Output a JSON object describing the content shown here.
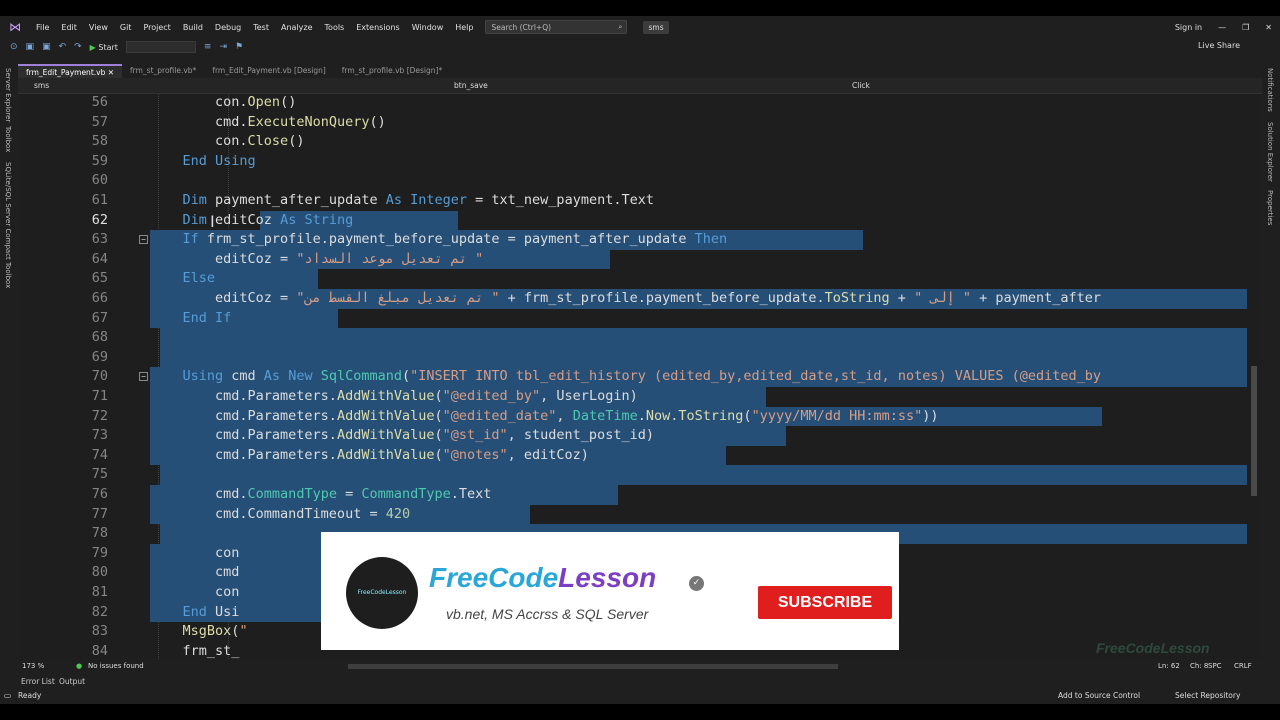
{
  "menubar": {
    "items": [
      "File",
      "Edit",
      "View",
      "Git",
      "Project",
      "Build",
      "Debug",
      "Test",
      "Analyze",
      "Tools",
      "Extensions",
      "Window",
      "Help"
    ],
    "search_placeholder": "Search (Ctrl+Q)",
    "solution_badge": "sms",
    "sign_in": "Sign in"
  },
  "toolbar": {
    "start_label": "Start",
    "live_share": "Live Share"
  },
  "left_strip": [
    "Server Explorer",
    "Toolbox",
    "SQLite/SQL Server Compact Toolbox"
  ],
  "right_strip": [
    "Notifications",
    "Solution Explorer",
    "Properties"
  ],
  "tabs": [
    {
      "label": "frm_Edit_Payment.vb"
    },
    {
      "label": "frm_st_profile.vb*"
    },
    {
      "label": "frm_Edit_Payment.vb [Design]"
    },
    {
      "label": "frm_st_profile.vb [Design]*"
    }
  ],
  "navbar": {
    "project": "sms",
    "object": "btn_save",
    "event": "Click"
  },
  "code_lines": [
    {
      "n": "56",
      "code": "        con.Open()"
    },
    {
      "n": "57",
      "code": "        cmd.ExecuteNonQuery()"
    },
    {
      "n": "58",
      "code": "        con.Close()"
    },
    {
      "n": "59",
      "code": "    End Using"
    },
    {
      "n": "60",
      "code": ""
    },
    {
      "n": "61",
      "code": "    Dim payment_after_update As Integer = txt_new_payment.Text"
    },
    {
      "n": "62",
      "code": "    Dim editCoz As String"
    },
    {
      "n": "63",
      "code": "    If frm_st_profile.payment_before_update = payment_after_update Then"
    },
    {
      "n": "64",
      "code": "        editCoz = \"تم تعديل موعد السداد \""
    },
    {
      "n": "65",
      "code": "    Else"
    },
    {
      "n": "66",
      "code": "        editCoz = \"تم تعديل مبلغ القسط من \" + frm_st_profile.payment_before_update.ToString + \" إلى \" + payment_after"
    },
    {
      "n": "67",
      "code": "    End If"
    },
    {
      "n": "68",
      "code": ""
    },
    {
      "n": "69",
      "code": ""
    },
    {
      "n": "70",
      "code": "    Using cmd As New SqlCommand(\"INSERT INTO tbl_edit_history (edited_by,edited_date,st_id, notes) VALUES (@edited_by"
    },
    {
      "n": "71",
      "code": "        cmd.Parameters.AddWithValue(\"@edited_by\", UserLogin)"
    },
    {
      "n": "72",
      "code": "        cmd.Parameters.AddWithValue(\"@edited_date\", DateTime.Now.ToString(\"yyyy/MM/dd HH:mm:ss\"))"
    },
    {
      "n": "73",
      "code": "        cmd.Parameters.AddWithValue(\"@st_id\", student_post_id)"
    },
    {
      "n": "74",
      "code": "        cmd.Parameters.AddWithValue(\"@notes\", editCoz)"
    },
    {
      "n": "75",
      "code": ""
    },
    {
      "n": "76",
      "code": "        cmd.CommandType = CommandType.Text"
    },
    {
      "n": "77",
      "code": "        cmd.CommandTimeout = 420"
    },
    {
      "n": "78",
      "code": ""
    },
    {
      "n": "79",
      "code": "        con"
    },
    {
      "n": "80",
      "code": "        cmd"
    },
    {
      "n": "81",
      "code": "        con"
    },
    {
      "n": "82",
      "code": "    End Usi"
    },
    {
      "n": "83",
      "code": "    MsgBox(\"                                                  ... جاري ال\")"
    },
    {
      "n": "84",
      "code": "    frm_st_"
    }
  ],
  "editor_status": {
    "zoom": "173 %",
    "issues": "No issues found",
    "ln": "Ln: 62",
    "ch": "Ch: 8",
    "spc": "SPC",
    "crlf": "CRLF"
  },
  "panel_tabs": [
    "Error List",
    "Output"
  ],
  "statusbar": {
    "ready": "Ready",
    "source_control": "Add to Source Control",
    "repo": "Select Repository"
  },
  "promo": {
    "brand_part1": "FreeCode",
    "brand_part2": "Lesson",
    "tagline": "vb.net,  MS Accrss & SQL Server",
    "subscribe": "SUBSCRIBE",
    "avatar_text": "FreeCodeLesson",
    "watermark": "FreeCodeLesson"
  },
  "icons": [
    "vs-logo-icon",
    "search-icon",
    "play-icon",
    "undo-icon",
    "redo-icon",
    "save-icon",
    "bookmark-icon",
    "check-circle-icon",
    "verified-check-icon",
    "gear-icon",
    "cursor-icon"
  ]
}
